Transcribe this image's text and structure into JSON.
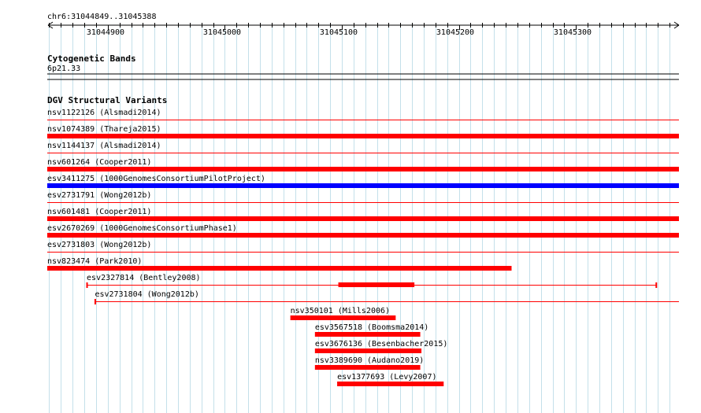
{
  "ruler": {
    "region": "chr6:31044849..31045388",
    "start": 31044849,
    "end": 31045388,
    "tick_labels": [
      "31044900",
      "31045000",
      "31045100",
      "31045200",
      "31045300"
    ]
  },
  "cytoband": {
    "title": "Cytogenetic Bands",
    "band": "6p21.33"
  },
  "dgv": {
    "title": "DGV Structural Variants",
    "variants": [
      {
        "label": "nsv1122126 (Alsmadi2014)",
        "color": "#ff0000",
        "start": 31044800,
        "end": 31045400,
        "style": "thin"
      },
      {
        "label": "nsv1074389 (Thareja2015)",
        "color": "#ff0000",
        "start": 31044800,
        "end": 31045400,
        "style": "thick"
      },
      {
        "label": "nsv1144137 (Alsmadi2014)",
        "color": "#ff0000",
        "start": 31044800,
        "end": 31045400,
        "style": "thin"
      },
      {
        "label": "nsv601264 (Cooper2011)",
        "color": "#ff0000",
        "start": 31044800,
        "end": 31045400,
        "style": "thick"
      },
      {
        "label": "esv3411275 (1000GenomesConsortiumPilotProject)",
        "color": "#0000ff",
        "start": 31044800,
        "end": 31045400,
        "style": "thick"
      },
      {
        "label": "esv2731791 (Wong2012b)",
        "color": "#ff0000",
        "start": 31044800,
        "end": 31045400,
        "style": "thin"
      },
      {
        "label": "nsv601481 (Cooper2011)",
        "color": "#ff0000",
        "start": 31044800,
        "end": 31045400,
        "style": "thick"
      },
      {
        "label": "esv2670269 (1000GenomesConsortiumPhase1)",
        "color": "#ff0000",
        "start": 31044800,
        "end": 31045400,
        "style": "thick"
      },
      {
        "label": "esv2731803 (Wong2012b)",
        "color": "#ff0000",
        "start": 31044800,
        "end": 31045400,
        "style": "thin"
      },
      {
        "label": "nsv823474 (Park2010)",
        "color": "#ff0000",
        "start": 31044800,
        "end": 31045245,
        "style": "thick"
      },
      {
        "label": "esv2327814 (Bentley2008)",
        "color": "#ff0000",
        "start": 31044882,
        "end": 31045369,
        "style": "split",
        "inner_start": 31045097,
        "inner_end": 31045162
      },
      {
        "label": "esv2731804 (Wong2012b)",
        "color": "#ff0000",
        "start": 31044889,
        "end": 31045400,
        "style": "thin-open"
      },
      {
        "label": "nsv350101 (Mills2006)",
        "color": "#ff0000",
        "start": 31045056,
        "end": 31045146,
        "style": "thick"
      },
      {
        "label": "esv3567518 (Boomsma2014)",
        "color": "#ff0000",
        "start": 31045077,
        "end": 31045167,
        "style": "thick"
      },
      {
        "label": "esv3676136 (Besenbacher2015)",
        "color": "#ff0000",
        "start": 31045077,
        "end": 31045168,
        "style": "thick"
      },
      {
        "label": "nsv3389690 (Audano2019)",
        "color": "#ff0000",
        "start": 31045077,
        "end": 31045167,
        "style": "thick"
      },
      {
        "label": "esv1377693 (Levy2007)",
        "color": "#ff0000",
        "start": 31045096,
        "end": 31045187,
        "style": "thick"
      }
    ]
  }
}
